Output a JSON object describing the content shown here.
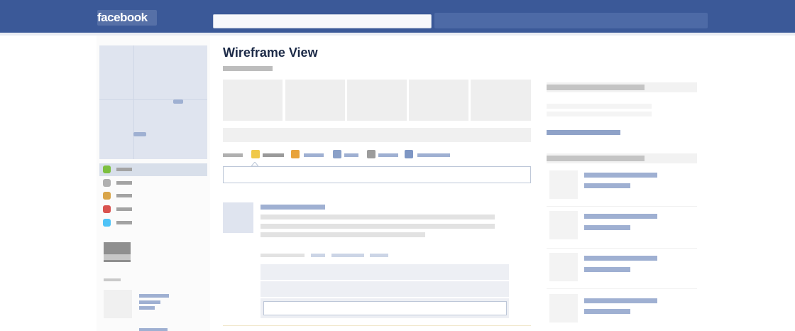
{
  "app": {
    "logo": "facebook"
  },
  "header": {
    "search_placeholder": ""
  },
  "main": {
    "page_title": "Wireframe View",
    "status_placeholder": ""
  },
  "colors": {
    "brand_blue": "#3b5998",
    "link_blue": "#9fb0d2",
    "title_text": "#1c2a47",
    "placeholder_gray": "#e2e2e2"
  },
  "left_nav": {
    "item_icon_colors": [
      "#7cbf3f",
      "#b0b0b0",
      "#d9a54a",
      "#d9534f",
      "#4fc3f7"
    ]
  },
  "publisher": {
    "icons": [
      "status-icon",
      "note-icon",
      "photo-icon",
      "link-icon",
      "event-icon",
      "video-icon"
    ],
    "icon_colors": [
      "#f0c94a",
      "#e8a33b",
      "#8aa0c8",
      "#9c9c9c",
      "#7f97c4"
    ]
  }
}
